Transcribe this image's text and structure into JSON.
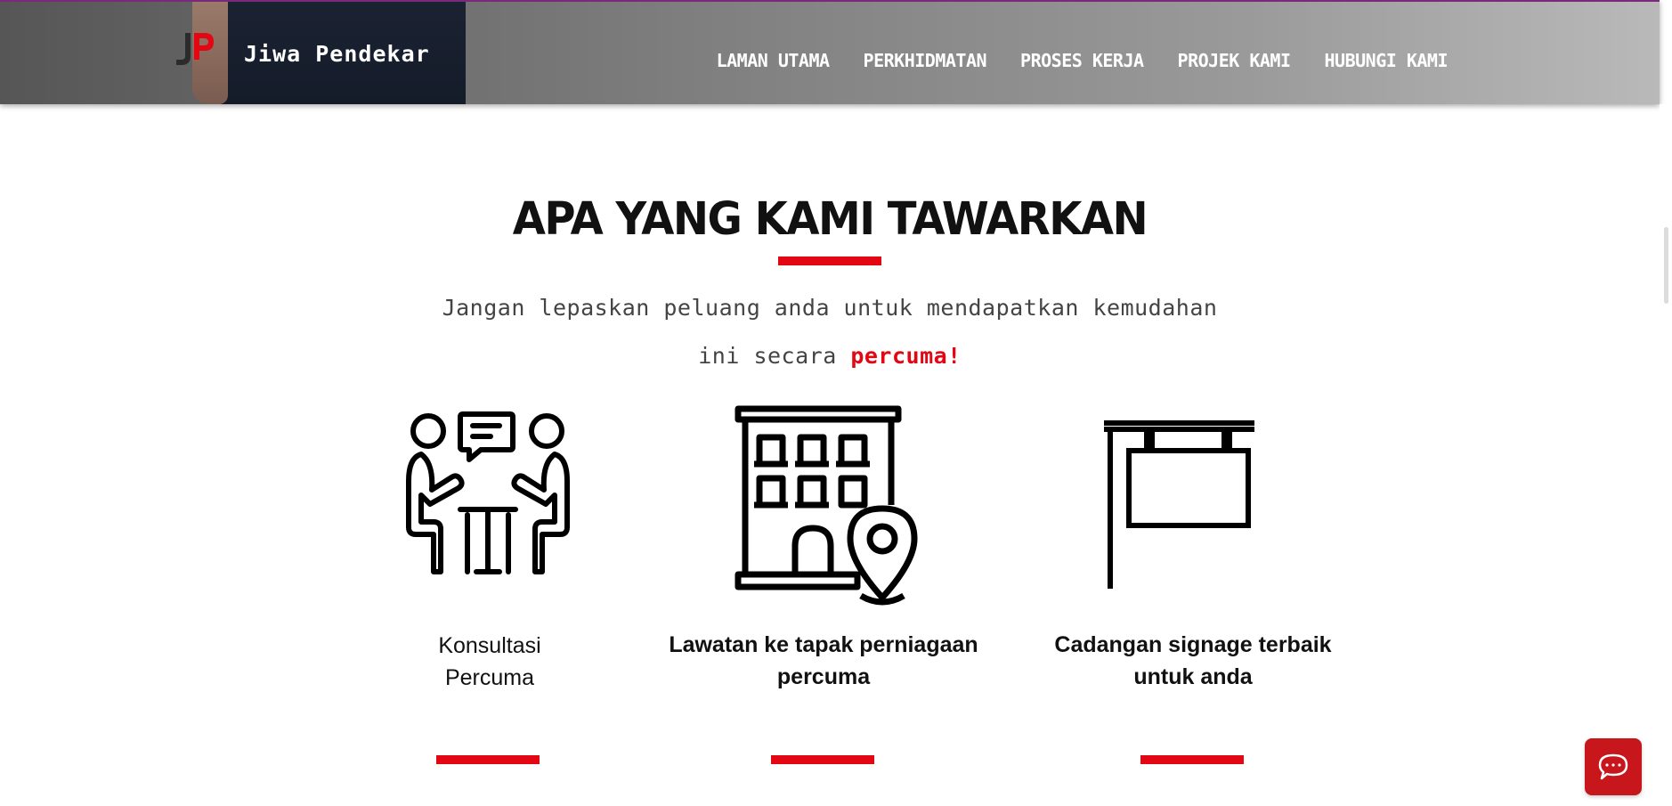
{
  "header": {
    "brand_name": "Jiwa Pendekar",
    "nav": [
      {
        "label": "LAMAN UTAMA"
      },
      {
        "label": "PERKHIDMATAN"
      },
      {
        "label": "PROSES KERJA"
      },
      {
        "label": "PROJEK KAMI"
      },
      {
        "label": "HUBUNGI KAMI"
      }
    ]
  },
  "section": {
    "title": "APA YANG KAMI TAWARKAN",
    "subtitle_line1": "Jangan lepaskan peluang anda untuk mendapatkan kemudahan",
    "subtitle_line2_prefix": "ini secara ",
    "subtitle_line2_accent": "percuma!",
    "cards": [
      {
        "icon": "consultation-icon",
        "line1": "Konsultasi",
        "line2": "Percuma"
      },
      {
        "icon": "building-location-icon",
        "line1": "Lawatan ke tapak perniagaan",
        "line2": "percuma"
      },
      {
        "icon": "signboard-icon",
        "line1": "Cadangan signage terbaik",
        "line2": "untuk anda"
      }
    ]
  },
  "colors": {
    "accent": "#e30613",
    "chat_button": "#c8161d",
    "text_dark": "#111111"
  },
  "chat": {
    "icon": "chat-bubble-icon"
  }
}
